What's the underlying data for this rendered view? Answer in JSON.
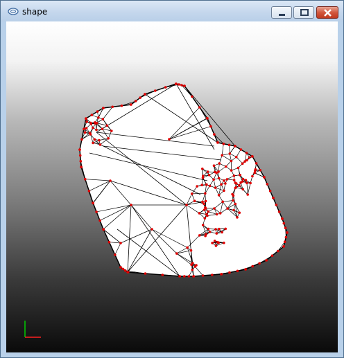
{
  "window": {
    "title": "shape",
    "controls": {
      "minimize": "minimize",
      "maximize": "maximize",
      "close": "close"
    }
  },
  "viewport": {
    "description_icons": {
      "axes": "axes-triad-icon"
    },
    "colors": {
      "vertex": "#e00000",
      "edge": "#000000",
      "face": "#ffffff",
      "axis_x": "#ff0000",
      "axis_y": "#00cc00"
    }
  }
}
